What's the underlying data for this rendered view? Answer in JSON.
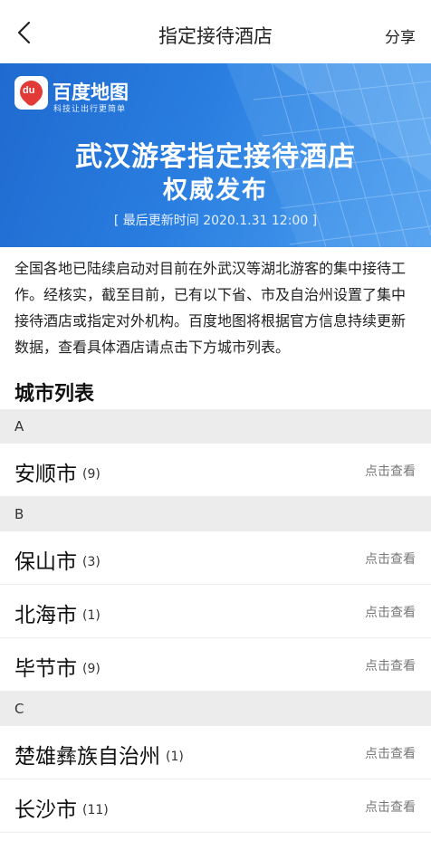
{
  "nav": {
    "title": "指定接待酒店",
    "share_label": "分享"
  },
  "banner": {
    "logo_mark": "du",
    "brand": "百度地图",
    "slogan": "科技让出行更简单",
    "headline": "武汉游客指定接待酒店",
    "subheadline": "权威发布",
    "updated": "[ 最后更新时间 2020.1.31 12:00 ]"
  },
  "intro": "全国各地已陆续启动对目前在外武汉等湖北游客的集中接待工作。经核实，截至目前，已有以下省、市及自治州设置了集中接待酒店或指定对外机构。百度地图将根据官方信息持续更新数据，查看具体酒店请点击下方城市列表。",
  "list_title": "城市列表",
  "view_label": "点击查看",
  "sections": [
    {
      "letter": "A",
      "cities": [
        {
          "name": "安顺市",
          "count": "(9)"
        }
      ]
    },
    {
      "letter": "B",
      "cities": [
        {
          "name": "保山市",
          "count": "(3)"
        },
        {
          "name": "北海市",
          "count": "(1)"
        },
        {
          "name": "毕节市",
          "count": "(9)"
        }
      ]
    },
    {
      "letter": "C",
      "cities": [
        {
          "name": "楚雄彝族自治州",
          "count": "(1)"
        },
        {
          "name": "长沙市",
          "count": "(11)"
        }
      ]
    }
  ]
}
